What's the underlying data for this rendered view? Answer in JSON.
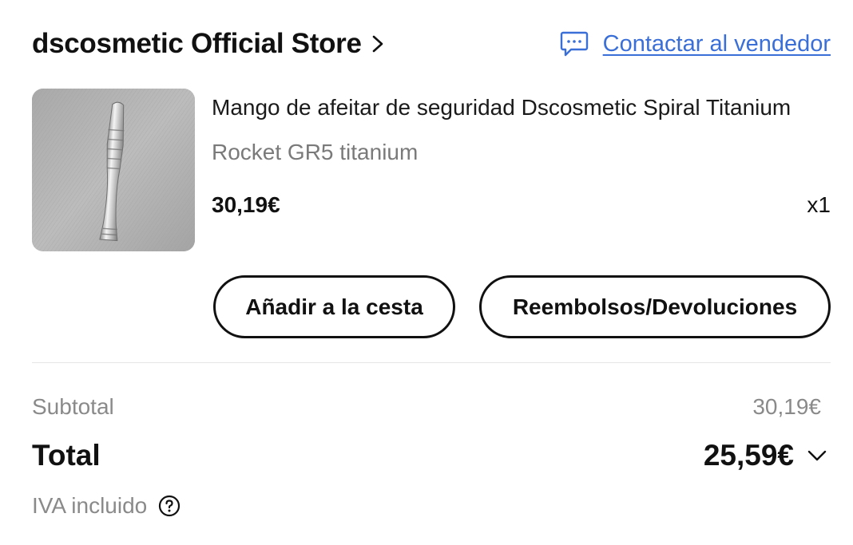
{
  "store": {
    "name": "dscosmetic Official Store",
    "contact_label": "Contactar al vendedor",
    "contact_icon": "chat-icon",
    "link_icon": "chevron-right-icon"
  },
  "product": {
    "title": "Mango de afeitar de seguridad Dscosmetic Spiral Titanium",
    "variant": "Rocket GR5 titanium",
    "price": "30,19€",
    "quantity": "x1",
    "image_icon": "product-image"
  },
  "actions": {
    "add_to_cart": "Añadir a la cesta",
    "refunds": "Reembolsos/Devoluciones"
  },
  "summary": {
    "subtotal_label": "Subtotal",
    "subtotal_value": "30,19€",
    "total_label": "Total",
    "total_value": "25,59€",
    "expand_icon": "chevron-down-icon",
    "tax_label": "IVA incluido",
    "tax_help_icon": "help-icon"
  },
  "colors": {
    "link": "#3a6fd8",
    "text": "#111111",
    "muted": "#8a8a8a"
  }
}
